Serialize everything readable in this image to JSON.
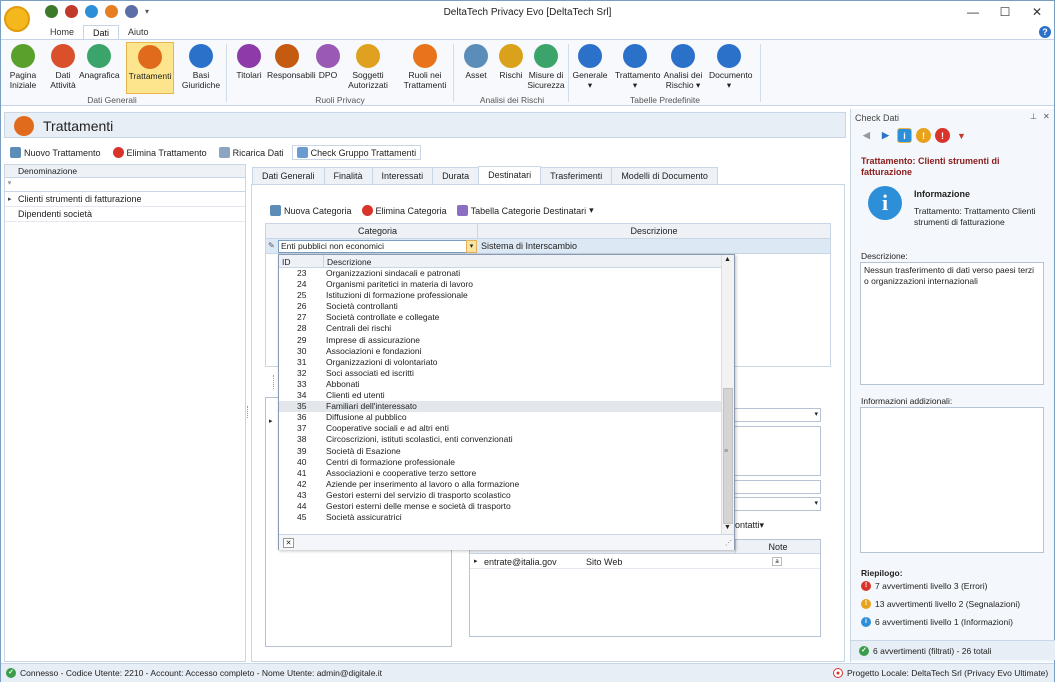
{
  "window": {
    "title": "DeltaTech Privacy Evo [DeltaTech Srl]",
    "controls": {
      "minimize": "—",
      "maximize": "☐",
      "close": "✕"
    }
  },
  "ribbon_tabs": [
    "Home",
    "Dati",
    "Aiuto"
  ],
  "ribbon": {
    "groups": [
      {
        "label": "Dati Generali",
        "buttons": [
          {
            "label1": "Pagina",
            "label2": "Iniziale",
            "color": "#5aa02c"
          },
          {
            "label1": "Dati",
            "label2": "Attività",
            "color": "#d9502b"
          },
          {
            "label1": "Anagrafica",
            "label2": "",
            "color": "#3aa46a"
          },
          {
            "label1": "Trattamenti",
            "label2": "",
            "color": "#e06b1d"
          },
          {
            "label1": "Basi",
            "label2": "Giuridiche",
            "color": "#2c71c9"
          }
        ]
      },
      {
        "label": "Ruoli Privacy",
        "buttons": [
          {
            "label1": "Titolari",
            "label2": "",
            "color": "#8e3aa8"
          },
          {
            "label1": "Responsabili",
            "label2": "",
            "color": "#c55a11"
          },
          {
            "label1": "DPO",
            "label2": "",
            "color": "#9b59b6"
          },
          {
            "label1": "Soggetti",
            "label2": "Autorizzati",
            "color": "#e0a020"
          },
          {
            "label1": "Ruoli nei",
            "label2": "Trattamenti",
            "color": "#e8731c"
          }
        ]
      },
      {
        "label": "Analisi dei Rischi",
        "buttons": [
          {
            "label1": "Asset",
            "label2": "",
            "color": "#5b8db8"
          },
          {
            "label1": "Rischi",
            "label2": "",
            "color": "#d9a21a"
          },
          {
            "label1": "Misure di",
            "label2": "Sicurezza",
            "color": "#3aa46a"
          }
        ]
      },
      {
        "label": "Tabelle Predefinite",
        "buttons": [
          {
            "label1": "Generale",
            "label2": "▾",
            "color": "#2c71c9"
          },
          {
            "label1": "Trattamento",
            "label2": "▾",
            "color": "#2c71c9"
          },
          {
            "label1": "Analisi dei",
            "label2": "Rischio ▾",
            "color": "#2c71c9"
          },
          {
            "label1": "Documento",
            "label2": "▾",
            "color": "#2c71c9"
          }
        ]
      }
    ]
  },
  "doc": {
    "title": "Trattamenti"
  },
  "toolbar": {
    "new": "Nuovo Trattamento",
    "delete": "Elimina Trattamento",
    "reload": "Ricarica Dati",
    "check": "Check Gruppo Trattamenti"
  },
  "left_grid": {
    "header": "Denominazione",
    "rows": [
      "Clienti strumenti di fatturazione",
      "Dipendenti società"
    ]
  },
  "page_tabs": [
    "Dati Generali",
    "Finalità",
    "Interessati",
    "Durata",
    "Destinatari",
    "Trasferimenti",
    "Modelli di Documento"
  ],
  "dest_toolbar": {
    "new": "Nuova Categoria",
    "delete": "Elimina Categoria",
    "table": "Tabella Categorie Destinatari"
  },
  "cat_grid": {
    "col_categoria": "Categoria",
    "col_descrizione": "Descrizione",
    "combo_value": "Enti pubblici non economici",
    "descr_value": "Sistema di Interscambio"
  },
  "dropdown": {
    "col_id": "ID",
    "col_desc": "Descrizione",
    "rows": [
      {
        "id": "23",
        "d": "Organizzazioni sindacali e patronati"
      },
      {
        "id": "24",
        "d": "Organismi paritetici in materia di lavoro"
      },
      {
        "id": "25",
        "d": "Istituzioni di formazione professionale"
      },
      {
        "id": "26",
        "d": "Società controllanti"
      },
      {
        "id": "27",
        "d": "Società controllate e collegate"
      },
      {
        "id": "28",
        "d": "Centrali dei rischi"
      },
      {
        "id": "29",
        "d": "Imprese di assicurazione"
      },
      {
        "id": "30",
        "d": "Associazioni e fondazioni"
      },
      {
        "id": "31",
        "d": "Organizzazioni di volontariato"
      },
      {
        "id": "32",
        "d": "Soci associati ed iscritti"
      },
      {
        "id": "33",
        "d": "Abbonati"
      },
      {
        "id": "34",
        "d": "Clienti ed utenti"
      },
      {
        "id": "35",
        "d": "Familiari dell'interessato"
      },
      {
        "id": "36",
        "d": "Diffusione al pubblico"
      },
      {
        "id": "37",
        "d": "Cooperative sociali e ad altri enti"
      },
      {
        "id": "38",
        "d": "Circoscrizioni, istituti scolastici, enti convenzionati"
      },
      {
        "id": "39",
        "d": "Società di Esazione"
      },
      {
        "id": "40",
        "d": "Centri di formazione professionale"
      },
      {
        "id": "41",
        "d": "Associazioni e cooperative terzo settore"
      },
      {
        "id": "42",
        "d": "Aziende per inserimento al lavoro o alla formazione"
      },
      {
        "id": "43",
        "d": "Gestori esterni del servizio di trasporto scolastico"
      },
      {
        "id": "44",
        "d": "Gestori esterni delle mense e società di trasporto"
      },
      {
        "id": "45",
        "d": "Società assicuratrici"
      }
    ],
    "highlighted_id": "35"
  },
  "contacts": {
    "button": "ontatti",
    "col_note": "Note",
    "row_email": "entrate@italia.gov",
    "row_type": "Sito Web"
  },
  "check": {
    "panel_title": "Check Dati",
    "heading": "Trattamento: Clienti strumenti di fatturazione",
    "info_title": "Informazione",
    "info_text": "Trattamento: Trattamento Clienti strumenti di fatturazione",
    "descr_label": "Descrizione:",
    "descr_text": "Nessun trasferimento di dati verso paesi terzi o organizzazioni internazionali",
    "add_label": "Informazioni addizionali:",
    "summary_label": "Riepilogo:",
    "sum1": "7 avvertimenti livello 3 (Errori)",
    "sum2": "13 avvertimenti livello 2 (Segnalazioni)",
    "sum3": "6 avvertimenti livello 1 (Informazioni)",
    "footer": "6 avvertimenti (filtrati) - 26 totali"
  },
  "status": {
    "left": "Connesso - Codice Utente: 2210 - Account: Accesso completo - Nome Utente: admin@digitale.it",
    "right": "Progetto Locale: DeltaTech Srl (Privacy Evo Ultimate)"
  }
}
